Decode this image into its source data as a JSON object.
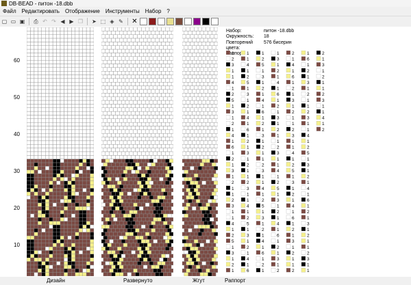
{
  "window": {
    "title": "DB-BEAD - питон -18.dbb"
  },
  "menu": [
    "Файл",
    "Редактировать",
    "Отображение",
    "Инструменты",
    "Набор",
    "?"
  ],
  "toolbar": {
    "icons": [
      "new-file-icon",
      "open-folder-icon",
      "save-icon",
      "print-icon",
      "undo-icon",
      "redo-icon",
      "arrow-left-icon",
      "arrow-right-icon",
      "copy-icon",
      "pointer-icon",
      "select-rect-icon",
      "fill-bucket-icon",
      "pencil-icon"
    ],
    "palette": [
      "#ffffff",
      "#8b1a1a",
      "#ffffff",
      "#e8e090",
      "#7a4a3a",
      "#ffffff",
      "#8b008b",
      "#000000",
      "#ffffff"
    ]
  },
  "ruler": {
    "labels": [
      "60",
      "50",
      "40",
      "30",
      "20",
      "10"
    ]
  },
  "info": {
    "set_label": "Набор:",
    "set_value": "питон -18.dbb",
    "circ_label": "Окружность:",
    "circ_value": "18",
    "repeat_label": "Повторений цвета:",
    "repeat_value": "576 бисерин",
    "rapport_label": "Раппорт"
  },
  "status": {
    "design": "Дизайн",
    "unrolled": "Развернуто",
    "rope": "Жгут",
    "rapport": "Раппорт"
  },
  "colors": {
    "black": "#000000",
    "brown": "#7b4a43",
    "yellow": "#f5f08c",
    "white": "#ffffff",
    "line": "#8c8c8c"
  }
}
